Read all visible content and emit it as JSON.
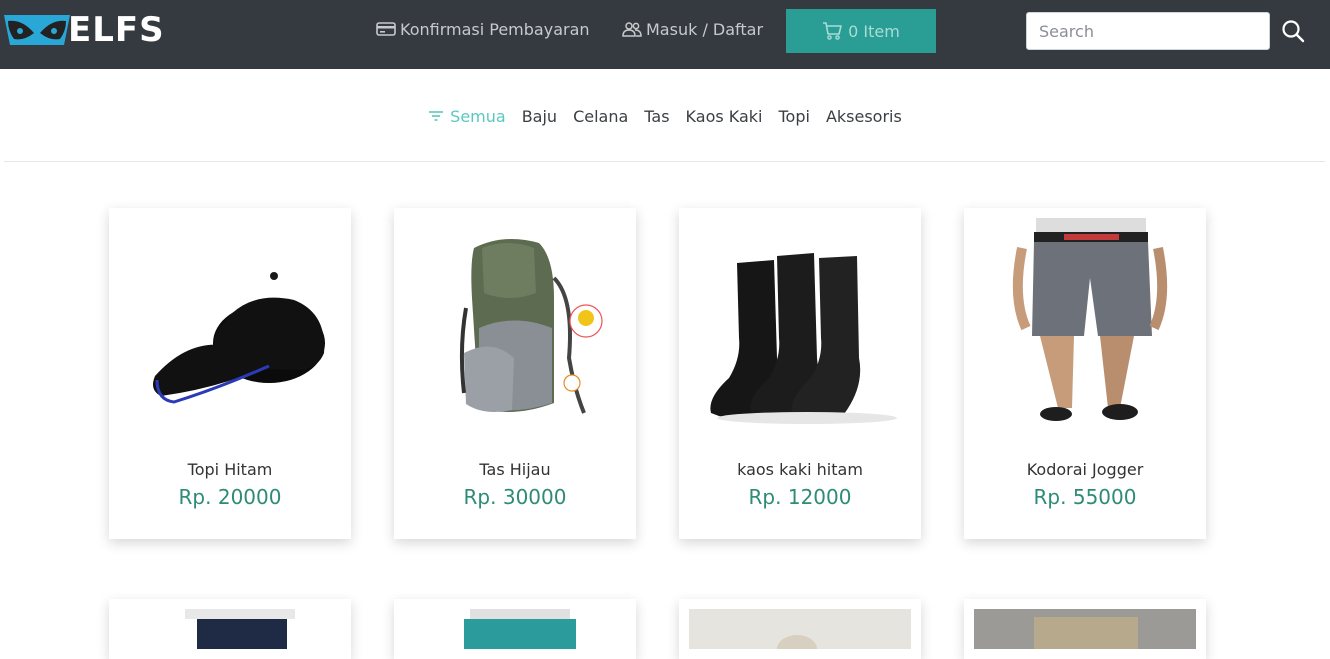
{
  "brand": {
    "name": "ELFS"
  },
  "header": {
    "confirm_label": "Konfirmasi Pembayaran",
    "login_label": "Masuk / Daftar",
    "cart_label": "0 Item",
    "search_placeholder": "Search"
  },
  "categories": {
    "active": "Semua",
    "items": [
      "Baju",
      "Celana",
      "Tas",
      "Kaos Kaki",
      "Topi",
      "Aksesoris"
    ]
  },
  "products": [
    {
      "name": "Topi Hitam",
      "price": "Rp. 20000"
    },
    {
      "name": "Tas Hijau",
      "price": "Rp. 30000"
    },
    {
      "name": "kaos kaki hitam",
      "price": "Rp. 12000"
    },
    {
      "name": "Kodorai Jogger",
      "price": "Rp. 55000"
    }
  ],
  "colors": {
    "header_bg": "#343a40",
    "accent": "#2a9d94",
    "active_category": "#5ac8c0",
    "price": "#2e8b76"
  }
}
